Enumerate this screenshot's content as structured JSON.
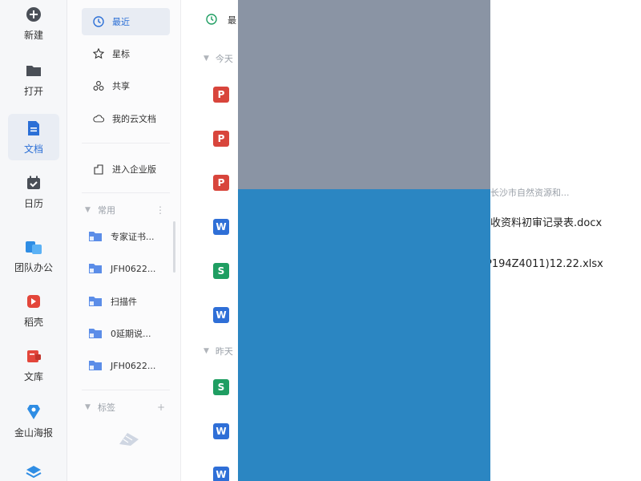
{
  "rail": {
    "items": [
      {
        "label": "新建",
        "icon": "plus-circle-icon"
      },
      {
        "label": "打开",
        "icon": "folder-icon"
      },
      {
        "label": "文档",
        "icon": "document-icon",
        "active": true
      },
      {
        "label": "日历",
        "icon": "calendar-icon"
      },
      {
        "label": "团队办公",
        "icon": "team-office-icon"
      },
      {
        "label": "稻壳",
        "icon": "docer-icon"
      },
      {
        "label": "文库",
        "icon": "library-icon"
      },
      {
        "label": "金山海报",
        "icon": "poster-icon"
      }
    ]
  },
  "nav": {
    "items": [
      {
        "label": "最近",
        "icon": "clock-icon",
        "active": true
      },
      {
        "label": "星标",
        "icon": "star-icon"
      },
      {
        "label": "共享",
        "icon": "share-icon"
      },
      {
        "label": "我的云文档",
        "icon": "cloud-icon"
      }
    ],
    "enterprise": {
      "label": "进入企业版",
      "icon": "enterprise-icon"
    },
    "common_section": {
      "label": "常用"
    },
    "folders": [
      {
        "label": "专家证书..."
      },
      {
        "label": "JFH0622..."
      },
      {
        "label": "扫描件"
      },
      {
        "label": "0延期说..."
      },
      {
        "label": "JFH0622..."
      }
    ],
    "tags_section": {
      "label": "标签"
    }
  },
  "main": {
    "header_label": "最",
    "groups": [
      {
        "label": "今天"
      },
      {
        "label": "昨天"
      }
    ],
    "visible_texts": {
      "meta_1": "长沙市自然资源和...",
      "name_1": "收资料初审记录表.docx",
      "name_2": "P194Z4011)12.22.xlsx"
    }
  },
  "colors": {
    "accent": "#2b6fd6",
    "pdf": "#d8453c",
    "word": "#2f6fd7",
    "sheet": "#1f9e62",
    "overlay_top": "#8a94a4",
    "overlay_bottom": "#2b86c2"
  }
}
